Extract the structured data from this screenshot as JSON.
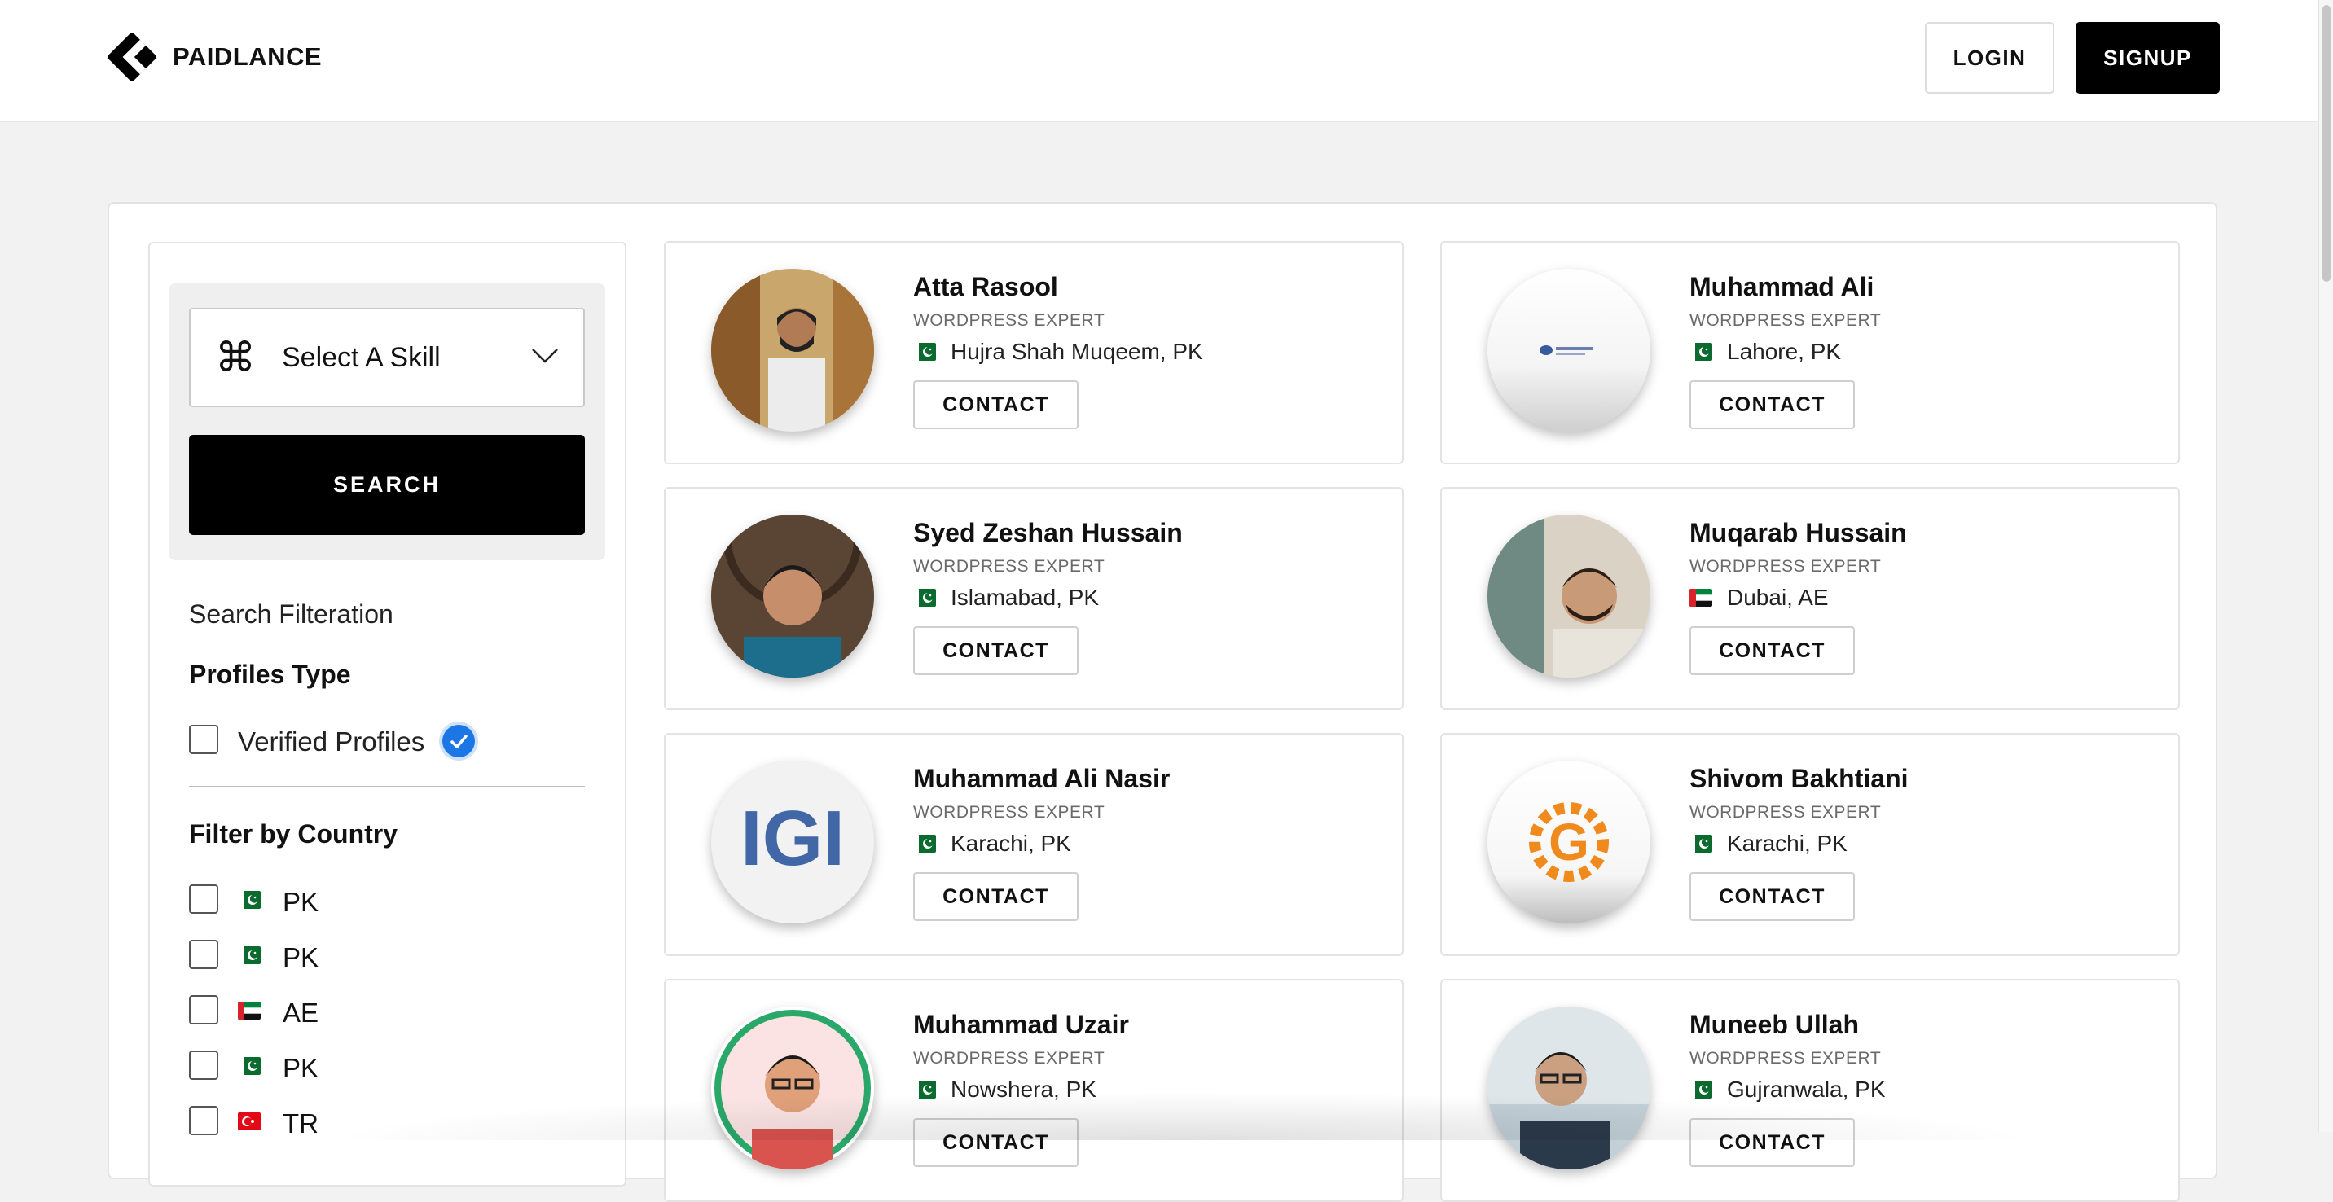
{
  "header": {
    "brand": "PAIDLANCE",
    "login_label": "LOGIN",
    "signup_label": "SIGNUP"
  },
  "search": {
    "skill_placeholder": "Select A Skill",
    "search_label": "SEARCH"
  },
  "filters": {
    "title": "Search Filteration",
    "profiles_type_title": "Profiles Type",
    "verified_label": "Verified Profiles",
    "country_title": "Filter by Country",
    "countries": [
      {
        "code": "PK",
        "flag": "flag-pk"
      },
      {
        "code": "PK",
        "flag": "flag-pk"
      },
      {
        "code": "AE",
        "flag": "flag-ae"
      },
      {
        "code": "PK",
        "flag": "flag-pk"
      },
      {
        "code": "TR",
        "flag": "flag-tr"
      }
    ]
  },
  "freelancers": [
    {
      "name": "Atta Rasool",
      "role": "WORDPRESS EXPERT",
      "location": "Hujra Shah Muqeem, PK",
      "flag": "flag-pk",
      "contact_label": "CONTACT"
    },
    {
      "name": "Muhammad Ali",
      "role": "WORDPRESS EXPERT",
      "location": "Lahore, PK",
      "flag": "flag-pk",
      "contact_label": "CONTACT"
    },
    {
      "name": "Syed Zeshan Hussain",
      "role": "WORDPRESS EXPERT",
      "location": "Islamabad, PK",
      "flag": "flag-pk",
      "contact_label": "CONTACT"
    },
    {
      "name": "Muqarab Hussain",
      "role": "WORDPRESS EXPERT",
      "location": "Dubai, AE",
      "flag": "flag-ae",
      "contact_label": "CONTACT"
    },
    {
      "name": "Muhammad Ali Nasir",
      "role": "WORDPRESS EXPERT",
      "location": "Karachi, PK",
      "flag": "flag-pk",
      "contact_label": "CONTACT"
    },
    {
      "name": "Shivom Bakhtiani",
      "role": "WORDPRESS EXPERT",
      "location": "Karachi, PK",
      "flag": "flag-pk",
      "contact_label": "CONTACT"
    },
    {
      "name": "Muhammad Uzair",
      "role": "WORDPRESS EXPERT",
      "location": "Nowshera, PK",
      "flag": "flag-pk",
      "contact_label": "CONTACT"
    },
    {
      "name": "Muneeb Ullah",
      "role": "WORDPRESS EXPERT",
      "location": "Gujranwala, PK",
      "flag": "flag-pk",
      "contact_label": "CONTACT"
    }
  ],
  "colors": {
    "accent": "#000000",
    "verified_blue": "#1d76e6",
    "background": "#f2f2f2"
  }
}
